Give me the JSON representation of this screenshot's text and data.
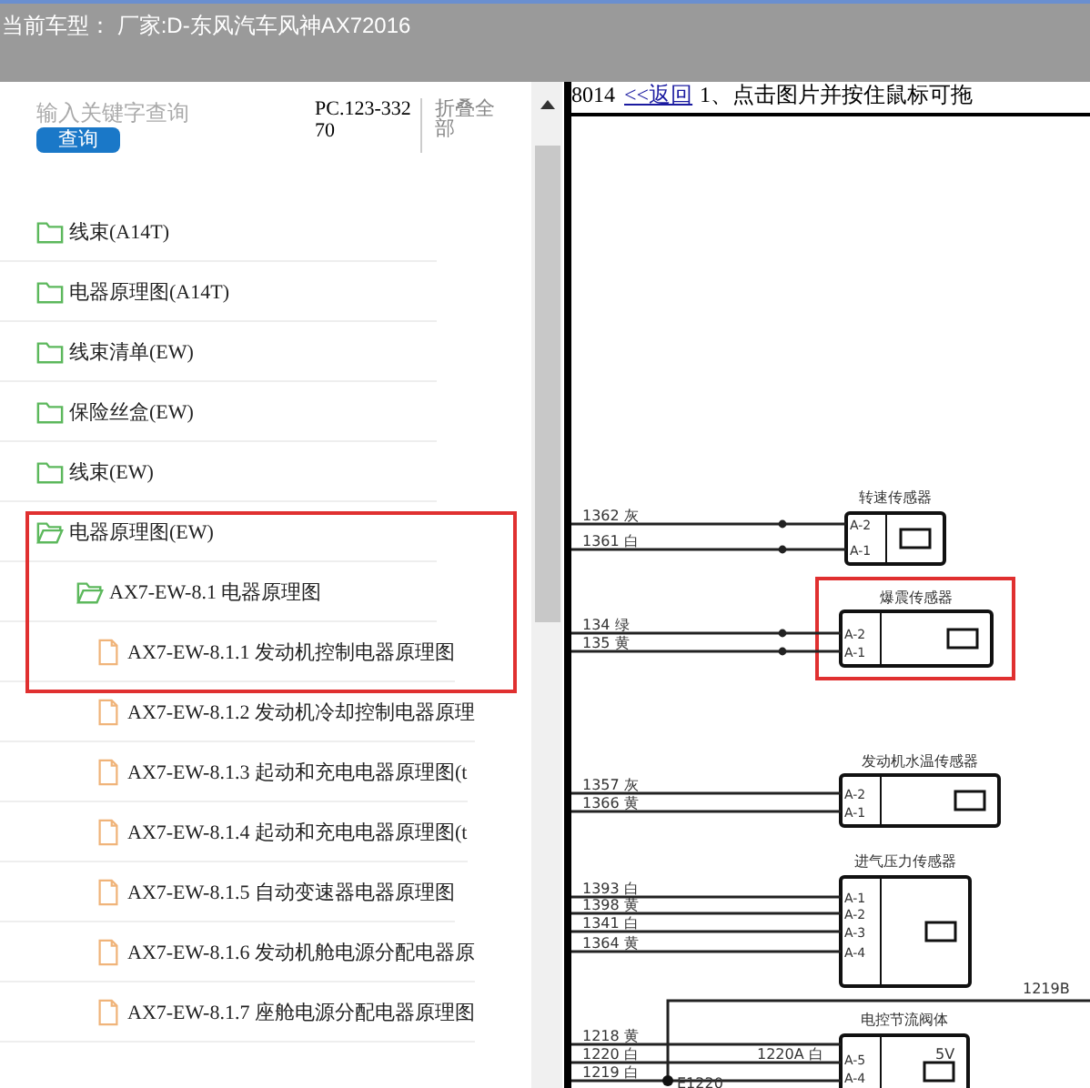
{
  "header": {
    "title": "当前车型： 厂家:D-东风汽车风神AX72016"
  },
  "search": {
    "placeholder": "输入关键字查询",
    "button": "查询",
    "code": "PC.123-33270",
    "collapse": "折叠全部"
  },
  "tree": [
    {
      "label": "线束(A14T)",
      "kind": "folder",
      "expanded": false
    },
    {
      "label": "电器原理图(A14T)",
      "kind": "folder",
      "expanded": false
    },
    {
      "label": "线束清单(EW)",
      "kind": "folder",
      "expanded": false
    },
    {
      "label": "保险丝盒(EW)",
      "kind": "folder",
      "expanded": false
    },
    {
      "label": "线束(EW)",
      "kind": "folder",
      "expanded": false
    },
    {
      "label": "电器原理图(EW)",
      "kind": "folder",
      "expanded": true,
      "children": [
        {
          "label": "AX7-EW-8.1 电器原理图",
          "kind": "folder",
          "expanded": true,
          "children": [
            {
              "label": "AX7-EW-8.1.1 发动机控制电器原理图",
              "kind": "file"
            },
            {
              "label": "AX7-EW-8.1.2 发动机冷却控制电器原理",
              "kind": "file"
            },
            {
              "label": "AX7-EW-8.1.3 起动和充电电器原理图(t",
              "kind": "file"
            },
            {
              "label": "AX7-EW-8.1.4 起动和充电电器原理图(t",
              "kind": "file"
            },
            {
              "label": "AX7-EW-8.1.5 自动变速器电器原理图",
              "kind": "file"
            },
            {
              "label": "AX7-EW-8.1.6 发动机舱电源分配电器原",
              "kind": "file"
            },
            {
              "label": "AX7-EW-8.1.7 座舱电源分配电器原理图",
              "kind": "file"
            }
          ]
        }
      ]
    }
  ],
  "content": {
    "code": "8014",
    "back_link": "<<返回",
    "hint": "1、点击图片并按住鼠标可拖"
  },
  "diagram": {
    "sensors": [
      {
        "title": "转速传感器",
        "pins": [
          "A-2",
          "A-1"
        ],
        "wires": [
          "1362 灰",
          "1361 白"
        ],
        "highlighted": false
      },
      {
        "title": "爆震传感器",
        "pins": [
          "A-2",
          "A-1"
        ],
        "wires": [
          "134 绿",
          "135 黄"
        ],
        "highlighted": true
      },
      {
        "title": "发动机水温传感器",
        "pins": [
          "A-2",
          "A-1"
        ],
        "wires": [
          "1357 灰",
          "1366 黄"
        ],
        "highlighted": false
      },
      {
        "title": "进气压力传感器",
        "pins": [
          "A-1",
          "A-2",
          "A-3",
          "A-4"
        ],
        "wires": [
          "1393 白",
          "1398 黄",
          "1341 白",
          "1364 黄"
        ],
        "highlighted": false
      },
      {
        "title": "电控节流阀体",
        "pins": [
          "A-5",
          "A-4"
        ],
        "wires": [
          "1220 白",
          "1219 白"
        ],
        "highlighted": false
      }
    ],
    "extra_labels": [
      "1219B",
      "1218 黄",
      "1220A 白",
      "E1220",
      "5V"
    ]
  }
}
